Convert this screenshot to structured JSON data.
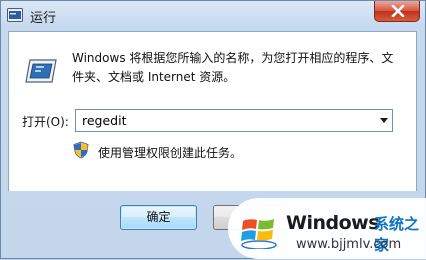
{
  "window": {
    "title": "运行",
    "icon": "run-app-icon"
  },
  "close_button": {
    "icon": "close-icon"
  },
  "dialog": {
    "description": "Windows 将根据您所输入的名称，为您打开相应的程序、文件夹、文档或 Internet 资源。",
    "open_label": "打开(O):",
    "open_value": "regedit",
    "admin_note": "使用管理权限创建此任务。"
  },
  "buttons": {
    "ok_label": "确定",
    "cancel_label": ""
  },
  "watermark": {
    "brand": "Windows",
    "site_name": "系统之家",
    "url": "www.bjjmlv.com"
  },
  "colors": {
    "title_bar": "#c6d9ee",
    "close_button": "#c7432c",
    "ok_button_border": "#3c7fb1",
    "watermark_site": "#0d72c6"
  }
}
